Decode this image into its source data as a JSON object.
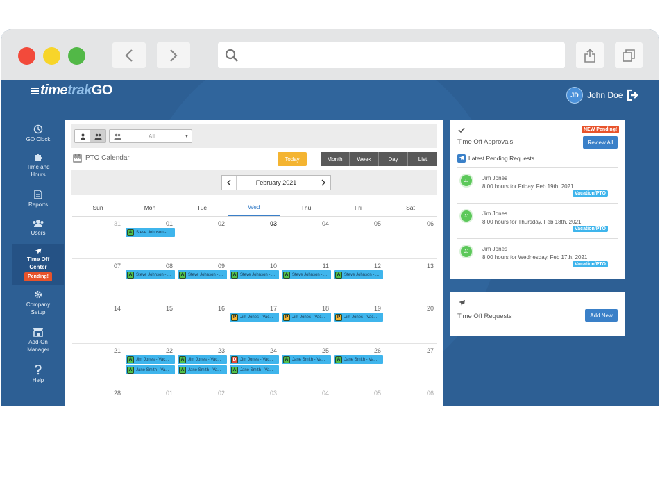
{
  "app": {
    "logo_time": "time",
    "logo_trak": "trak",
    "logo_go": "GO",
    "user_initials": "JD",
    "user_name": "John Doe"
  },
  "sidebar": {
    "items": [
      {
        "label1": "GO Clock",
        "label2": "",
        "icon": "clock-icon"
      },
      {
        "label1": "Time and",
        "label2": "Hours",
        "icon": "puzzle-icon"
      },
      {
        "label1": "Reports",
        "label2": "",
        "icon": "document-icon"
      },
      {
        "label1": "Users",
        "label2": "",
        "icon": "users-icon"
      },
      {
        "label1": "Time Off",
        "label2": "Center",
        "icon": "plane-icon",
        "badge": "Pending!"
      },
      {
        "label1": "Company",
        "label2": "Setup",
        "icon": "gear-icon"
      },
      {
        "label1": "Add-On",
        "label2": "Manager",
        "icon": "store-icon"
      },
      {
        "label1": "Help",
        "label2": "",
        "icon": "question-icon"
      }
    ]
  },
  "calendar": {
    "filter_value": "All",
    "title": "PTO Calendar",
    "today": "Today",
    "views": [
      "Month",
      "Week",
      "Day",
      "List"
    ],
    "month_label": "February 2021",
    "days": [
      "Sun",
      "Mon",
      "Tue",
      "Wed",
      "Thu",
      "Fri",
      "Sat"
    ],
    "weeks": [
      [
        "31",
        "01",
        "02",
        "03",
        "04",
        "05",
        "06"
      ],
      [
        "07",
        "08",
        "09",
        "10",
        "11",
        "12",
        "13"
      ],
      [
        "14",
        "15",
        "16",
        "17",
        "18",
        "19",
        "20"
      ],
      [
        "21",
        "22",
        "23",
        "24",
        "25",
        "26",
        "27"
      ],
      [
        "28",
        "01",
        "02",
        "03",
        "04",
        "05",
        "06"
      ]
    ],
    "events": {
      "steve": "Steve Johnson - ...",
      "jim": "Jim Jones - Vac...",
      "jane": "Jane Smith - Va..."
    },
    "status": {
      "approved": "A",
      "pending": "P",
      "denied": "D"
    }
  },
  "approvals": {
    "new_badge": "NEW Pending!",
    "title": "Time Off Approvals",
    "review_all": "Review All",
    "latest": "Latest Pending Requests",
    "requests": [
      {
        "initials": "JJ",
        "name": "Jim Jones",
        "desc": "8.00 hours for Friday, Feb 19th, 2021",
        "tag": "Vacation/PTO"
      },
      {
        "initials": "JJ",
        "name": "Jim Jones",
        "desc": "8.00 hours for Thursday, Feb 18th, 2021",
        "tag": "Vacation/PTO"
      },
      {
        "initials": "JJ",
        "name": "Jim Jones",
        "desc": "8.00 hours for Wednesday, Feb 17th, 2021",
        "tag": "Vacation/PTO"
      }
    ]
  },
  "timeoff": {
    "title": "Time Off Requests",
    "add_new": "Add New"
  }
}
